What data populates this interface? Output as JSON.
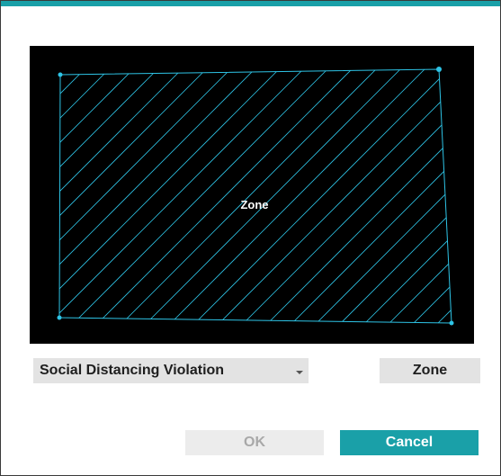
{
  "colors": {
    "accent": "#1aa0a8",
    "zone_line": "#2ec4e6",
    "canvas_background": "#000000",
    "button_background": "#e3e3e3"
  },
  "canvas": {
    "zone_label": "Zone"
  },
  "event_select": {
    "value": "Social Distancing Violation",
    "icon": "chevron-down-icon"
  },
  "buttons": {
    "zone": "Zone",
    "ok": "OK",
    "cancel": "Cancel"
  }
}
